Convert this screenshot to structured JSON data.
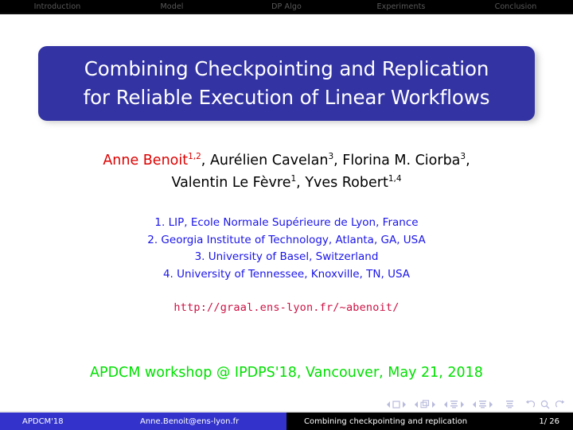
{
  "navbar": {
    "items": [
      {
        "label": "Introduction"
      },
      {
        "label": "Model"
      },
      {
        "label": "DP Algo"
      },
      {
        "label": "Experiments"
      },
      {
        "label": "Conclusion"
      }
    ],
    "background_color": "#000000",
    "text_color": "#5a5a5a"
  },
  "title": {
    "line1": "Combining Checkpointing and Replication",
    "line2": "for Reliable Execution of Linear Workflows",
    "box_color": "#3333a3",
    "text_color": "#ffffff"
  },
  "authors": {
    "line1": {
      "a1_name": "Anne Benoit",
      "a1_sup": "1,2",
      "sep1": ", ",
      "a2_name": "Aurélien Cavelan",
      "a2_sup": "3",
      "sep2": ", ",
      "a3_name": "Florina M. Ciorba",
      "a3_sup": "3",
      "sep3": ","
    },
    "line2": {
      "a4_name": "Valentin Le Fèvre",
      "a4_sup": "1",
      "sep4": ", ",
      "a5_name": "Yves Robert",
      "a5_sup": "1,4"
    },
    "highlight_color": "#dd0000",
    "text_color": "#000000"
  },
  "affiliations": {
    "items": [
      "1. LIP, Ecole Normale Supérieure de Lyon, France",
      "2. Georgia Institute of Technology, Atlanta, GA, USA",
      "3. University of Basel, Switzerland",
      "4. University of Tennessee, Knoxville, TN, USA"
    ],
    "color": "#1a14e8"
  },
  "url": {
    "text": "http://graal.ens-lyon.fr/~abenoit/",
    "color": "#cc1144"
  },
  "conference": {
    "text": "APDCM workshop @ IPDPS'18, Vancouver, May 21, 2018",
    "color": "#00e000"
  },
  "nav_symbols": {
    "items": [
      "first-slide-icon",
      "previous-frame-icon",
      "back-icon",
      "forward-icon",
      "last-slide-icon",
      "go-back-icon",
      "search-icon",
      "go-forward-icon"
    ],
    "color": "#b9bbdd"
  },
  "footer": {
    "venue": "APDCM'18",
    "email": "Anne.Benoit@ens-lyon.fr",
    "short_title": "Combining checkpointing and replication",
    "page": "1/ 26",
    "left_color": "#3333cc",
    "right_color": "#000000"
  }
}
